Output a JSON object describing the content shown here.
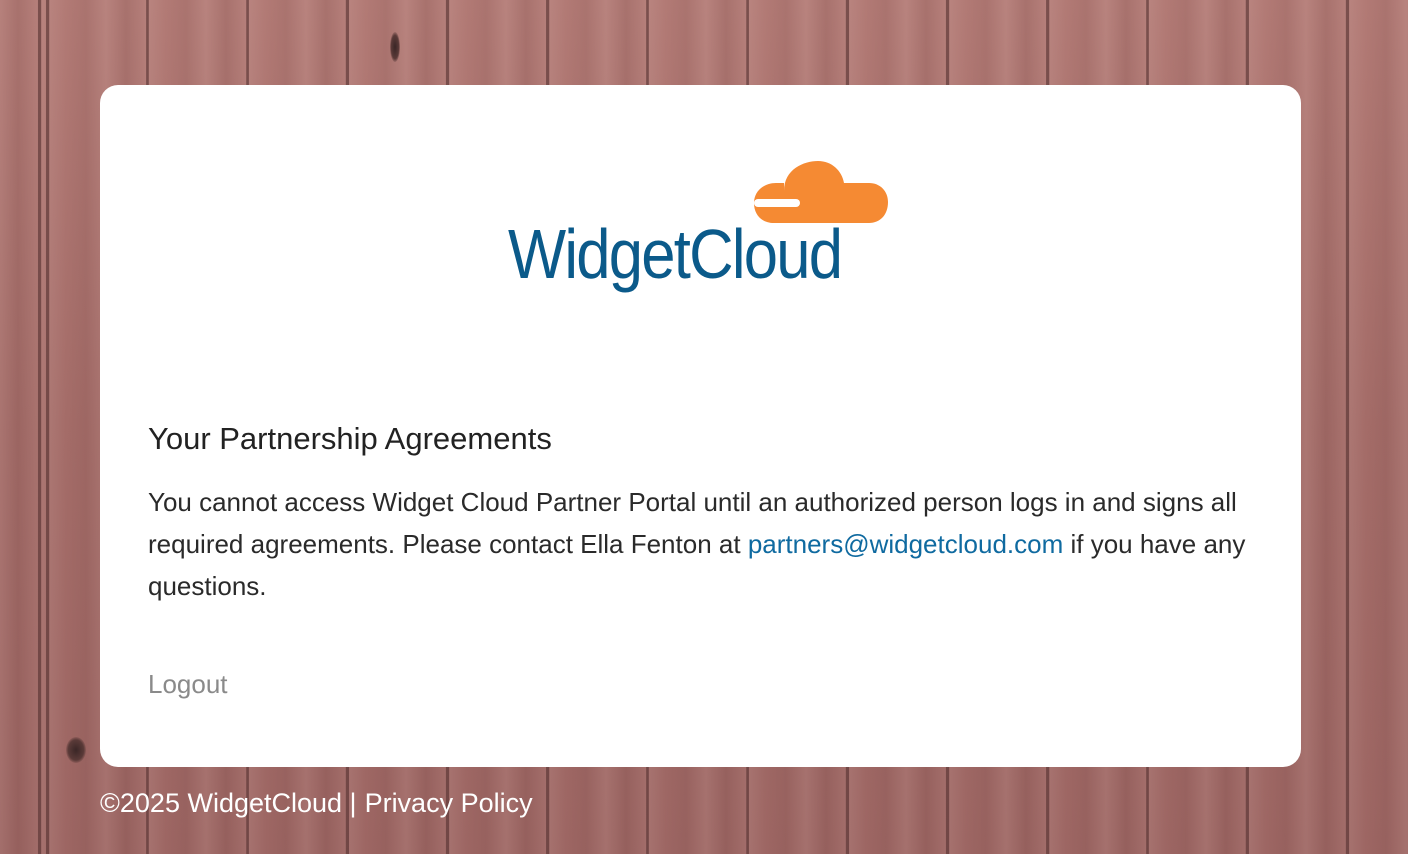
{
  "brand": {
    "name": "WidgetCloud",
    "text_color": "#0b5a8a",
    "accent_color": "#f58a33"
  },
  "agreements": {
    "heading": "Your Partnership Agreements",
    "message_pre": "You cannot access Widget Cloud Partner Portal until an authorized person logs in and signs all required agreements. Please contact Ella Fenton at",
    "contact_email": "partners@widgetcloud.com",
    "message_post": "if you have any questions."
  },
  "actions": {
    "logout_label": "Logout"
  },
  "footer": {
    "copyright": "©2025 WidgetCloud |",
    "privacy_label": "Privacy Policy"
  }
}
